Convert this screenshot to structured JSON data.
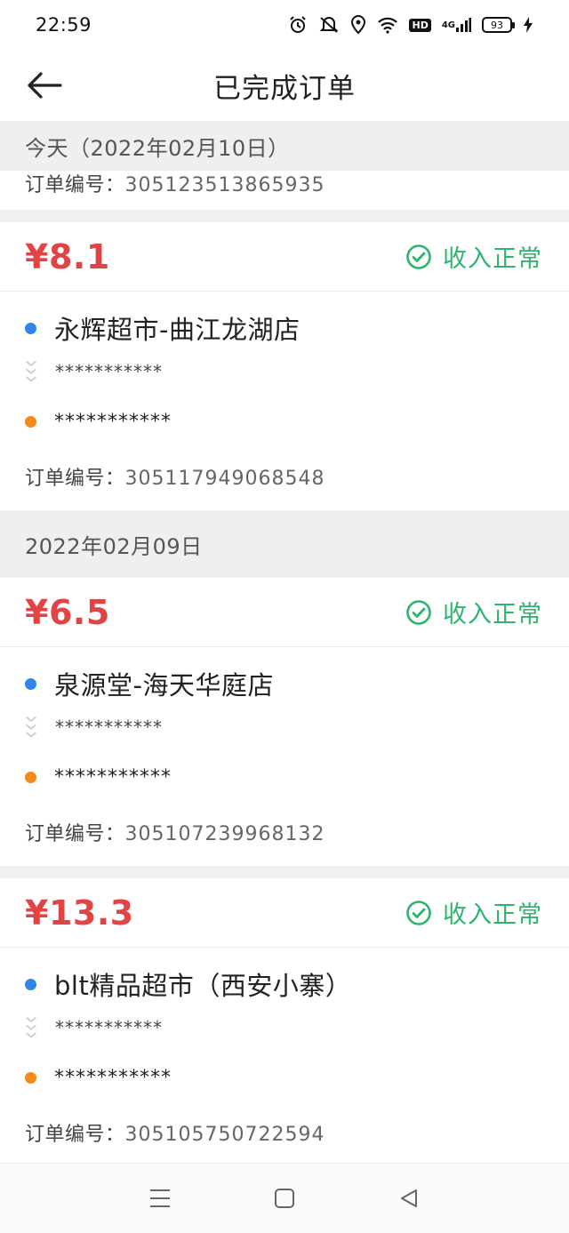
{
  "status_bar": {
    "time": "22:59",
    "hd": "HD",
    "network": "4G",
    "battery": "93",
    "icons": [
      "alarm-icon",
      "mute-icon",
      "location-icon",
      "wifi-icon",
      "signal-icon",
      "charging-icon"
    ]
  },
  "nav": {
    "title": "已完成订单",
    "back_icon": "arrow-left-icon"
  },
  "sections": [
    {
      "date": "今天（2022年02月10日）",
      "partial_order_label": "订单编号：",
      "partial_order_no": "305123513865935"
    },
    {
      "date": "2022年02月09日"
    }
  ],
  "orders": [
    {
      "price": "¥8.1",
      "status": "收入正常",
      "shop": "永辉超市-曲江龙湖店",
      "pickup_masked": "***********",
      "dropoff_masked": "***********",
      "order_label": "订单编号：",
      "order_no": "305117949068548"
    },
    {
      "price": "¥6.5",
      "status": "收入正常",
      "shop": "泉源堂-海天华庭店",
      "pickup_masked": "***********",
      "dropoff_masked": "***********",
      "order_label": "订单编号：",
      "order_no": "305107239968132"
    },
    {
      "price": "¥13.3",
      "status": "收入正常",
      "shop": "blt精品超市（西安小寨）",
      "pickup_masked": "***********",
      "dropoff_masked": "***********",
      "order_label": "订单编号：",
      "order_no": "305105750722594"
    }
  ],
  "colors": {
    "price": "#e04444",
    "status_ok": "#2db46f",
    "dot_pickup": "#2f86e8",
    "dot_dropoff": "#f28a1c"
  }
}
